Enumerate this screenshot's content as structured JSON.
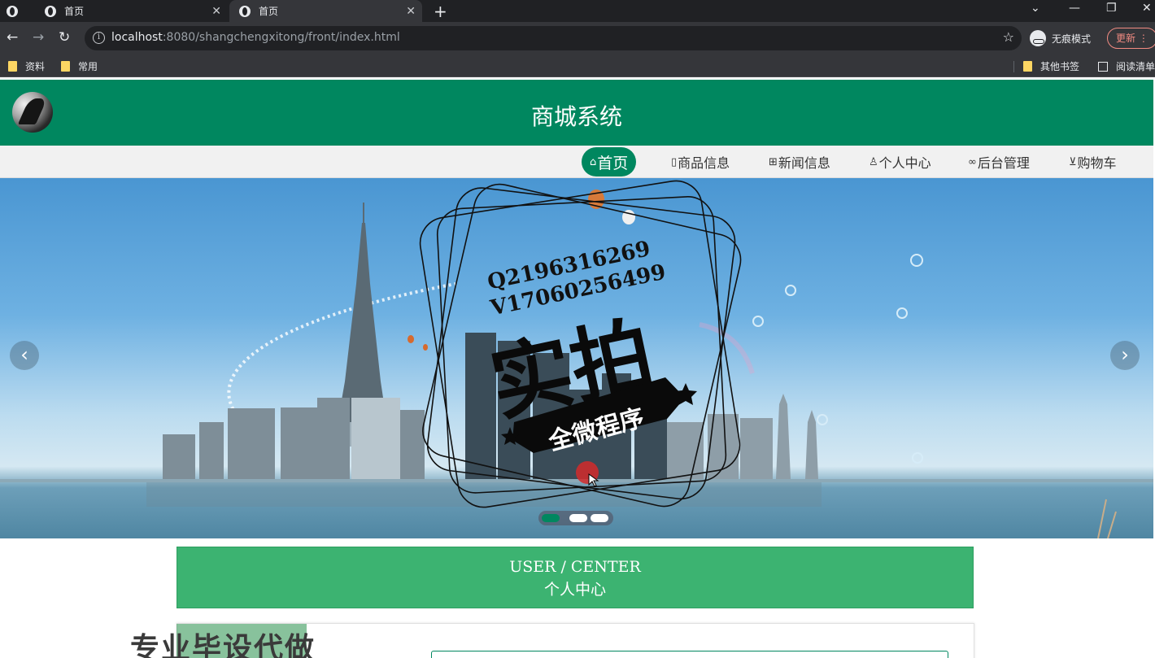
{
  "browser": {
    "tabs": [
      {
        "title": "首页"
      },
      {
        "title": "首页"
      }
    ],
    "url_host": "localhost",
    "url_path": ":8080/shangchengxitong/front/index.html",
    "incognito_label": "无痕模式",
    "update_label": "更新",
    "bookmarks": [
      "资料",
      "常用"
    ],
    "other_bookmarks": "其他书签",
    "reading_list": "阅读清单"
  },
  "site": {
    "title": "商城系统",
    "nav": [
      {
        "label": "首页",
        "icon": "home-icon",
        "active": true
      },
      {
        "label": "商品信息",
        "icon": "document-icon"
      },
      {
        "label": "新闻信息",
        "icon": "gift-icon"
      },
      {
        "label": "个人中心",
        "icon": "user-icon"
      },
      {
        "label": "后台管理",
        "icon": "link-icon"
      },
      {
        "label": "购物车",
        "icon": "cart-icon"
      }
    ]
  },
  "banner": {
    "watermark_qq": "Q2196316269",
    "watermark_v": "V17060256499",
    "stamp_big": "实拍",
    "stamp_ribbon": "全微程序",
    "active_slide": 1,
    "slide_count": 3
  },
  "user_center": {
    "en": "USER / CENTER",
    "zh": "个人中心"
  },
  "overlay_text": "专业毕设代做",
  "colors": {
    "brand_green": "#00875f",
    "panel_green": "#3cb371"
  }
}
